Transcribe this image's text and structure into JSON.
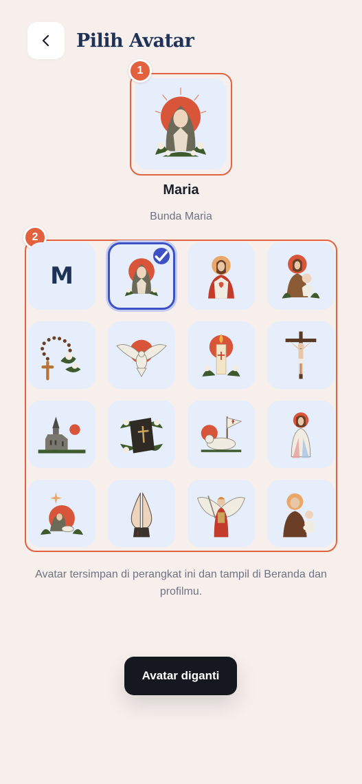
{
  "header": {
    "title": "Pilih Avatar",
    "back_icon": "chevron-left-icon"
  },
  "badges": {
    "preview": "1",
    "grid": "2"
  },
  "selected": {
    "name": "Maria",
    "subtitle": "Bunda Maria"
  },
  "grid": {
    "letter_tile": "M",
    "tiles": [
      {
        "icon": "letter-m"
      },
      {
        "icon": "mary-praying-icon",
        "selected": true
      },
      {
        "icon": "sacred-heart-icon"
      },
      {
        "icon": "holy-family-icon"
      },
      {
        "icon": "rosary-icon"
      },
      {
        "icon": "dove-icon"
      },
      {
        "icon": "candle-icon"
      },
      {
        "icon": "crucifix-icon"
      },
      {
        "icon": "church-icon"
      },
      {
        "icon": "bible-icon"
      },
      {
        "icon": "lamb-icon"
      },
      {
        "icon": "divine-mercy-icon"
      },
      {
        "icon": "nativity-icon"
      },
      {
        "icon": "praying-hands-icon"
      },
      {
        "icon": "archangel-icon"
      },
      {
        "icon": "saint-anthony-icon"
      }
    ]
  },
  "info_text": "Avatar tersimpan di perangkat ini dan tampil di Beranda dan profilmu.",
  "toast": {
    "label": "Avatar diganti"
  },
  "colors": {
    "accent": "#e2613f",
    "selection": "#3d51c4",
    "tile_bg": "#e6eefb",
    "title": "#1f3358"
  }
}
